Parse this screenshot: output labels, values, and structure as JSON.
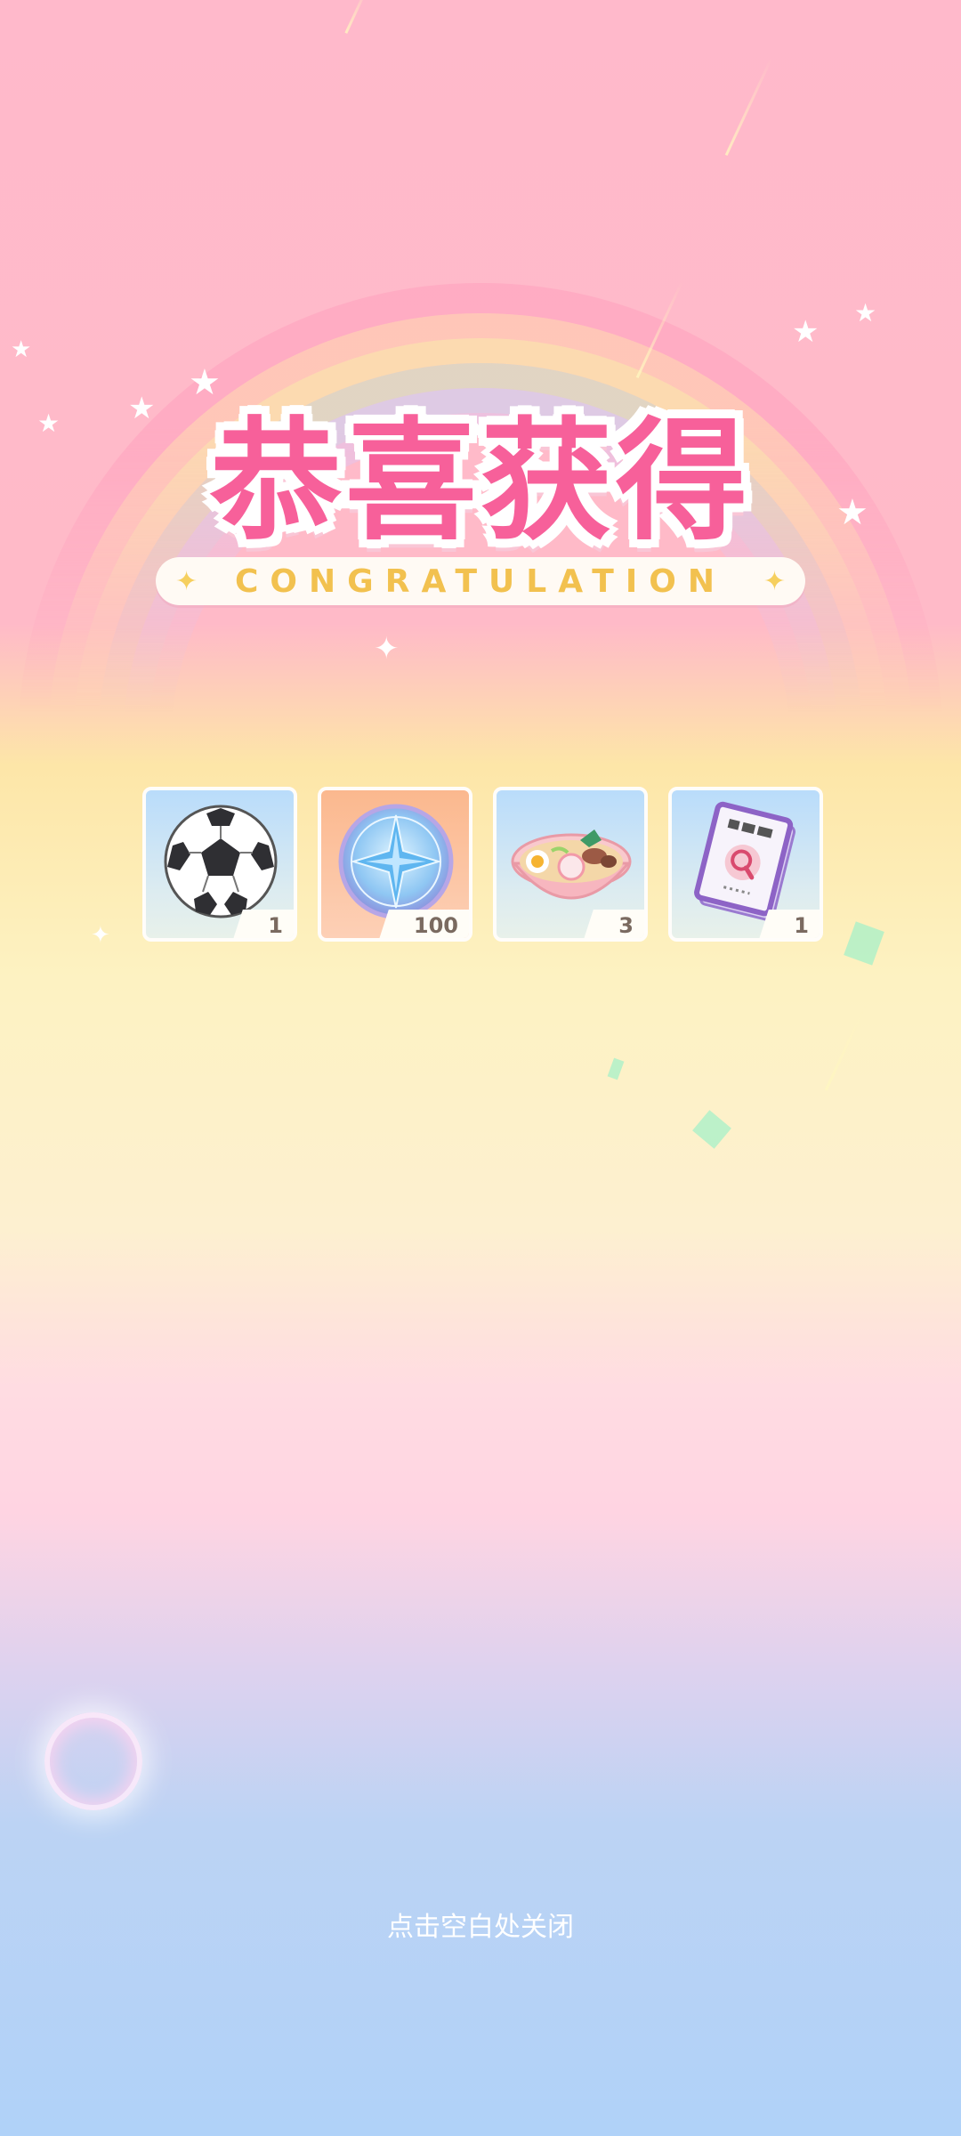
{
  "popup": {
    "title": "恭喜获得",
    "subtitle": "CONGRATULATION",
    "close_hint": "点击空白处关闭"
  },
  "rewards": [
    {
      "name": "soccer-ball",
      "icon": "soccer-ball-icon",
      "count": "1"
    },
    {
      "name": "star-coin",
      "icon": "star-coin-icon",
      "count": "100"
    },
    {
      "name": "ramen-bowl",
      "icon": "ramen-bowl-icon",
      "count": "3"
    },
    {
      "name": "magnifier-book",
      "icon": "magnifier-book-icon",
      "count": "1"
    }
  ],
  "colors": {
    "title": "#f7609a",
    "subtitle": "#f2c14f",
    "count_text": "#7a6a60"
  }
}
